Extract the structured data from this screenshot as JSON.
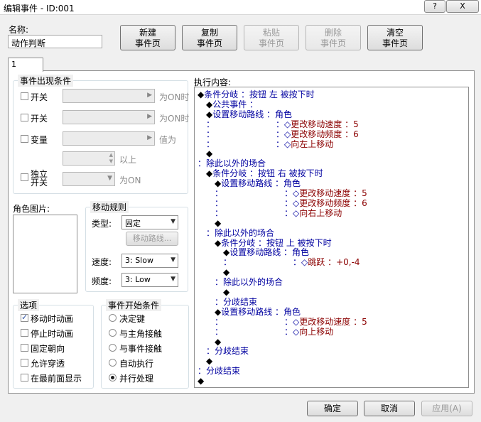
{
  "window": {
    "title": "编辑事件 - ID:001",
    "help_label": "?",
    "close_label": "X"
  },
  "name": {
    "label": "名称:",
    "value": "动作判断"
  },
  "top_buttons": [
    {
      "line1": "新建",
      "line2": "事件页",
      "enabled": true
    },
    {
      "line1": "复制",
      "line2": "事件页",
      "enabled": true
    },
    {
      "line1": "粘贴",
      "line2": "事件页",
      "enabled": false
    },
    {
      "line1": "删除",
      "line2": "事件页",
      "enabled": false
    },
    {
      "line1": "清空",
      "line2": "事件页",
      "enabled": true
    }
  ],
  "tab": {
    "label": "1"
  },
  "conditions": {
    "title": "事件出现条件",
    "switch1": {
      "label": "开关",
      "suffix": "为ON时"
    },
    "switch2": {
      "label": "开关",
      "suffix": "为ON时"
    },
    "variable": {
      "label": "变量",
      "suffix": "值为",
      "above_suffix": "以上"
    },
    "self_switch": {
      "label_line1": "独立",
      "label_line2": "开关",
      "suffix": "为ON"
    }
  },
  "character_graphic": {
    "label": "角色图片:"
  },
  "movement": {
    "title": "移动规则",
    "type_label": "类型:",
    "type_value": "固定",
    "route_button": "移动路线...",
    "speed_label": "速度:",
    "speed_value": "3: Slow",
    "freq_label": "频度:",
    "freq_value": "3: Low"
  },
  "options": {
    "title": "选项",
    "items": [
      {
        "label": "移动时动画",
        "checked": true
      },
      {
        "label": "停止时动画",
        "checked": false
      },
      {
        "label": "固定朝向",
        "checked": false
      },
      {
        "label": "允许穿透",
        "checked": false
      },
      {
        "label": "在最前面显示",
        "checked": false
      }
    ]
  },
  "trigger": {
    "title": "事件开始条件",
    "items": [
      {
        "label": "决定键",
        "selected": false
      },
      {
        "label": "与主角接触",
        "selected": false
      },
      {
        "label": "与事件接触",
        "selected": false
      },
      {
        "label": "自动执行",
        "selected": false
      },
      {
        "label": "并行处理",
        "selected": true
      }
    ]
  },
  "contents": {
    "label": "执行内容:",
    "lines": [
      {
        "indent": 0,
        "prefix": "◆",
        "text": "条件分岐 ：按钮 左 被按下时"
      },
      {
        "indent": 1,
        "prefix": "◆",
        "text": "公共事件 ："
      },
      {
        "indent": 1,
        "prefix": "◆",
        "text": "设置移动路线 ：角色"
      },
      {
        "indent": 1,
        "prefix": "：",
        "pad": 8,
        "sub": "：◇",
        "text": "更改移动速度 ：5",
        "red": true
      },
      {
        "indent": 1,
        "prefix": "：",
        "pad": 8,
        "sub": "：◇",
        "text": "更改移动频度 ：6",
        "red": true
      },
      {
        "indent": 1,
        "prefix": "：",
        "pad": 8,
        "sub": "：◇",
        "text": "向左上移动",
        "red": true
      },
      {
        "indent": 1,
        "prefix": "◆",
        "text": ""
      },
      {
        "indent": 0,
        "prefix": "：",
        "text": "除此以外的场合"
      },
      {
        "indent": 1,
        "prefix": "◆",
        "text": "条件分岐 ：按钮 右 被按下时"
      },
      {
        "indent": 2,
        "prefix": "◆",
        "text": "设置移动路线 ：角色"
      },
      {
        "indent": 2,
        "prefix": "：",
        "pad": 8,
        "sub": "：◇",
        "text": "更改移动速度 ：5",
        "red": true
      },
      {
        "indent": 2,
        "prefix": "：",
        "pad": 8,
        "sub": "：◇",
        "text": "更改移动频度 ：6",
        "red": true
      },
      {
        "indent": 2,
        "prefix": "：",
        "pad": 8,
        "sub": "：◇",
        "text": "向右上移动",
        "red": true
      },
      {
        "indent": 2,
        "prefix": "◆",
        "text": ""
      },
      {
        "indent": 1,
        "prefix": "：",
        "text": "除此以外的场合"
      },
      {
        "indent": 2,
        "prefix": "◆",
        "text": "条件分岐 ：按钮 上 被按下时"
      },
      {
        "indent": 3,
        "prefix": "◆",
        "text": "设置移动路线 ：角色"
      },
      {
        "indent": 3,
        "prefix": "：",
        "pad": 8,
        "sub": "：◇",
        "text": "跳跃 ：+0,-4",
        "red": true
      },
      {
        "indent": 3,
        "prefix": "◆",
        "text": ""
      },
      {
        "indent": 2,
        "prefix": "：",
        "text": "除此以外的场合"
      },
      {
        "indent": 3,
        "prefix": "◆",
        "text": ""
      },
      {
        "indent": 2,
        "prefix": "：",
        "text": "分歧结束"
      },
      {
        "indent": 2,
        "prefix": "◆",
        "text": "设置移动路线 ：角色"
      },
      {
        "indent": 2,
        "prefix": "：",
        "pad": 8,
        "sub": "：◇",
        "text": "更改移动速度 ：5",
        "red": true
      },
      {
        "indent": 2,
        "prefix": "：",
        "pad": 8,
        "sub": "：◇",
        "text": "向上移动",
        "red": true
      },
      {
        "indent": 2,
        "prefix": "◆",
        "text": ""
      },
      {
        "indent": 1,
        "prefix": "：",
        "text": "分歧结束"
      },
      {
        "indent": 1,
        "prefix": "◆",
        "text": ""
      },
      {
        "indent": 0,
        "prefix": "：",
        "text": "分歧结束"
      },
      {
        "indent": 0,
        "prefix": "◆",
        "text": ""
      }
    ]
  },
  "footer": {
    "ok": "确定",
    "cancel": "取消",
    "apply": "应用(A)"
  }
}
